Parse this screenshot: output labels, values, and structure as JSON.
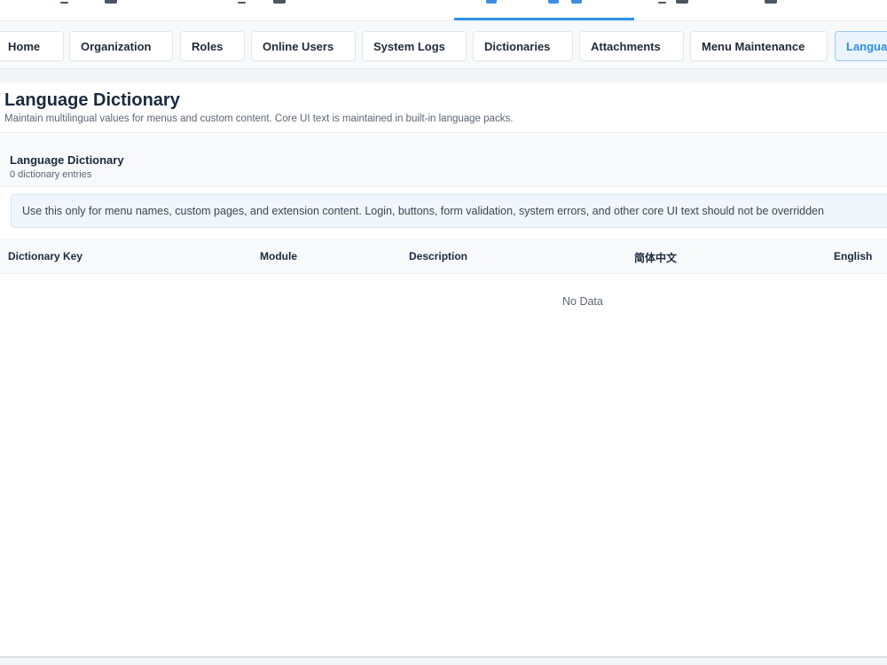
{
  "tabs": [
    {
      "label": "Home",
      "active": false
    },
    {
      "label": "Organization",
      "active": false
    },
    {
      "label": "Roles",
      "active": false
    },
    {
      "label": "Online Users",
      "active": false
    },
    {
      "label": "System Logs",
      "active": false
    },
    {
      "label": "Dictionaries",
      "active": false
    },
    {
      "label": "Attachments",
      "active": false
    },
    {
      "label": "Menu Maintenance",
      "active": false
    },
    {
      "label": "Langua",
      "active": true
    }
  ],
  "page": {
    "title": "Language Dictionary",
    "description": "Maintain multilingual values for menus and custom content. Core UI text is maintained in built-in language packs."
  },
  "card": {
    "title": "Language Dictionary",
    "subtitle": "0 dictionary entries",
    "notice": "Use this only for menu names, custom pages, and extension content. Login, buttons, form validation, system errors, and other core UI text should not be overridden"
  },
  "table": {
    "columns": [
      "Dictionary Key",
      "Module",
      "Description",
      "简体中文",
      "English"
    ],
    "rows": [],
    "empty_text": "No Data"
  },
  "colors": {
    "accent": "#2f8de4",
    "active_tab_bg": "#eaf4ff",
    "notice_bg": "#f0f6fc"
  }
}
